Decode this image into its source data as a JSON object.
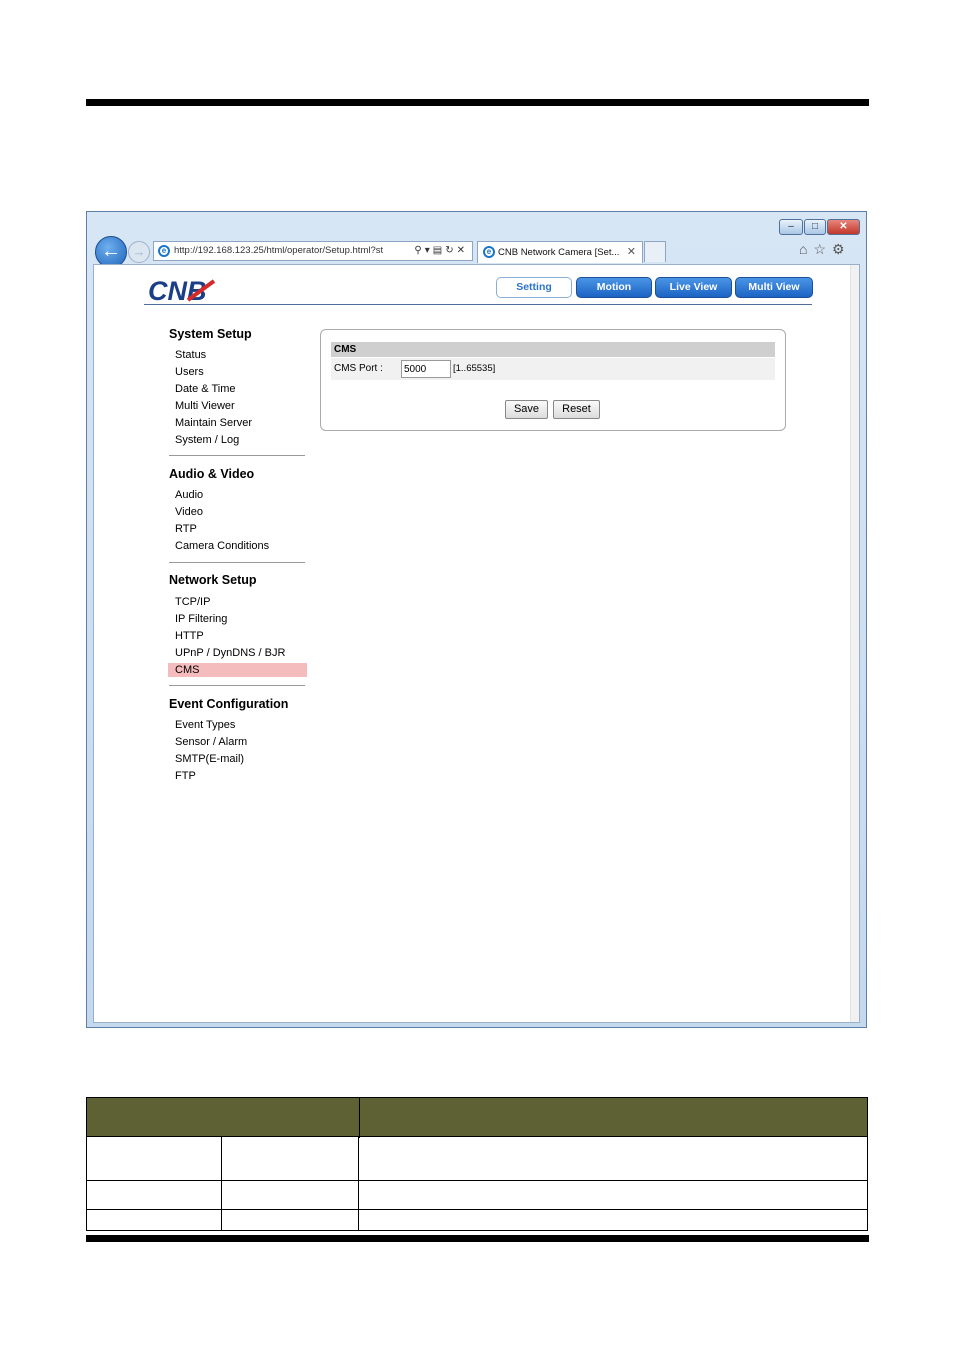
{
  "browser": {
    "address_url": "http://192.168.123.25/html/operator/Setup.html?st",
    "tab_title": "CNB Network Camera [Set...",
    "window_controls": {
      "minimize": "–",
      "maximize": "□",
      "close": "✕"
    },
    "icons": [
      "back-arrow-icon",
      "forward-arrow-icon",
      "ie-logo-icon",
      "search-icon",
      "refresh-icon",
      "stop-icon",
      "home-icon",
      "favorites-star-icon",
      "tools-gear-icon"
    ]
  },
  "app": {
    "logo": "CNB",
    "nav": {
      "setting": "Setting",
      "motion": "Motion",
      "live_view": "Live View",
      "multi_view": "Multi View"
    },
    "menu": {
      "system_setup": {
        "title": "System Setup",
        "items": [
          "Status",
          "Users",
          "Date & Time",
          "Multi Viewer",
          "Maintain Server",
          "System / Log"
        ]
      },
      "audio_video": {
        "title": "Audio & Video",
        "items": [
          "Audio",
          "Video",
          "RTP",
          "Camera Conditions"
        ]
      },
      "network_setup": {
        "title": "Network Setup",
        "items": [
          "TCP/IP",
          "IP Filtering",
          "HTTP",
          "UPnP / DynDNS / BJR",
          "CMS"
        ],
        "active_item": "CMS"
      },
      "event_configuration": {
        "title": "Event Configuration",
        "items": [
          "Event Types",
          "Sensor / Alarm",
          "SMTP(E-mail)",
          "FTP"
        ]
      }
    },
    "cms_panel": {
      "header": "CMS",
      "port_label": "CMS Port :",
      "port_value": "5000",
      "port_range": "[1..65535]",
      "save_label": "Save",
      "reset_label": "Reset"
    }
  },
  "colors": {
    "nav_blue": "#1c63c4",
    "active_menu": "#f4bcbc",
    "table_header": "#5e6134"
  }
}
